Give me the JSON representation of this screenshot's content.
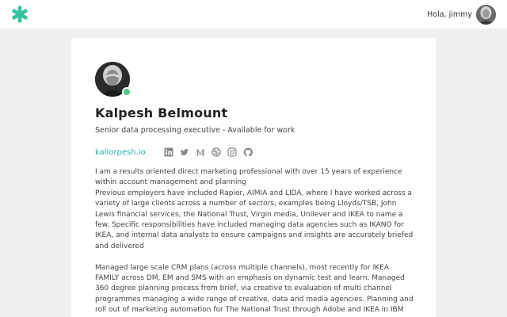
{
  "colors": {
    "accent": "#2bb0a8",
    "logo": "#35c3a0",
    "online": "#4cc98a",
    "background": "#f0f0f0"
  },
  "header": {
    "logo_icon": "asterisk-logo-icon",
    "greeting": "Hola, jimmy"
  },
  "profile": {
    "name": "Kalpesh Belmount",
    "headline": "Senior data processing executive - Available for work",
    "website": "kaliorpesh.io",
    "social_icons": [
      "linkedin-icon",
      "twitter-icon",
      "medium-icon",
      "dribbble-icon",
      "instagram-icon",
      "github-icon"
    ],
    "bio": [
      "I am a results oriented direct marketing professional with over 15 years of experience\nwithin account management and planning\nPrevious employers have included Rapier, AIMIA and LIDA, where I have worked across a\nvariety of large clients across a number of sectors, examples being Lloyds/TSB, John\nLewis financial services, the National Trust, Virgin media, Unilever and IKEA to name a\nfew. Specific responsibilities have included managing data agencies such as IKANO for\nIKEA, and internal data analysts to ensure campaigns and insights are accurately briefed\nand delivered",
      "Managed large scale CRM plans (across multiple channels), most recently for IKEA\nFAMILY across DM, EM and SMS with an emphasis on dynamic test and learn. Managed\n360 degree planning process from brief, via creative to evaluation of multi channel\nprogrammes managing a wide range of creative, data and media agencies. Planning and\nroll out of marketing automation for The National Trust through Adobe and IKEA in IBM"
    ]
  }
}
